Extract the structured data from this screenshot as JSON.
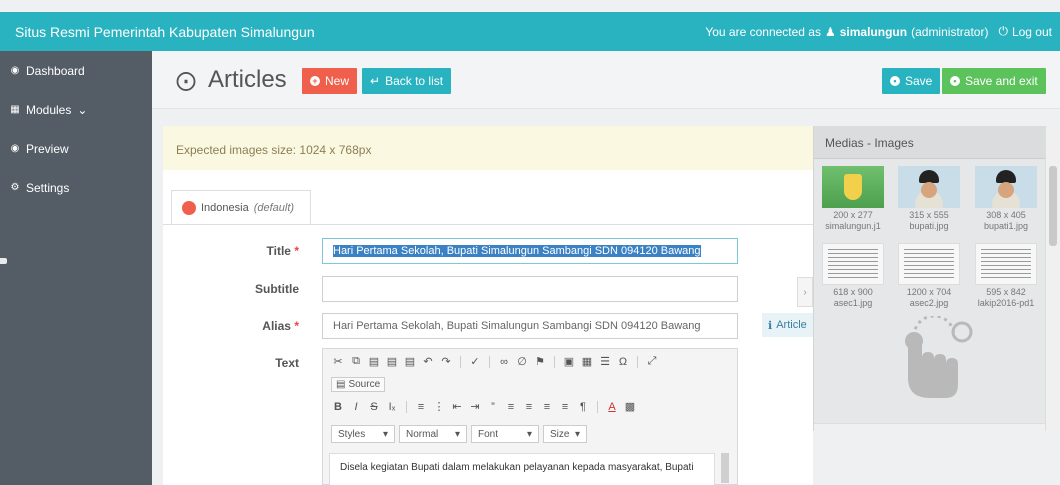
{
  "topbar": {
    "site_title": "Situs Resmi Pemerintah Kabupaten Simalungun",
    "connected_prefix": "You are connected as",
    "username": "simalungun",
    "role": "(administrator)",
    "logout_label": "Log out"
  },
  "sidebar": {
    "items": [
      {
        "label": "Dashboard",
        "icon": "dashboard-icon"
      },
      {
        "label": "Modules",
        "icon": "grid-icon",
        "chevron": "⌄"
      },
      {
        "label": "Preview",
        "icon": "eye-icon"
      },
      {
        "label": "Settings",
        "icon": "gear-icon"
      }
    ]
  },
  "header": {
    "title": "Articles",
    "new_label": "New",
    "back_label": "Back to list",
    "save_label": "Save",
    "save_exit_label": "Save and exit"
  },
  "form": {
    "notice": "Expected images size: 1024 x 768px",
    "language_tab": "Indonesia",
    "language_tab_note": "(default)",
    "title_label": "Title",
    "title_value": "Hari Pertama Sekolah, Bupati Simalungun Sambangi SDN 094120 Bawang",
    "subtitle_label": "Subtitle",
    "subtitle_value": "",
    "alias_label": "Alias",
    "alias_value": "Hari Pertama Sekolah, Bupati Simalungun Sambangi SDN 094120 Bawang",
    "text_label": "Text",
    "required_mark": "*",
    "article_hint": "Article"
  },
  "editor": {
    "source_label": "Source",
    "styles_label": "Styles",
    "format_label": "Normal",
    "font_label": "Font",
    "size_label": "Size",
    "body_text": "Disela kegiatan Bupati dalam melakukan pelayanan kepada masyarakat, Bupati"
  },
  "media": {
    "title": "Medias - Images",
    "items": [
      {
        "dims": "200 x 277",
        "name": "simalungun.j1"
      },
      {
        "dims": "315 x 555",
        "name": "bupati.jpg"
      },
      {
        "dims": "308 x 405",
        "name": "bupati1.jpg"
      },
      {
        "dims": "618 x 900",
        "name": "asec1.jpg"
      },
      {
        "dims": "1200 x 704",
        "name": "asec2.jpg"
      },
      {
        "dims": "595 x 842",
        "name": "lakip2016-pd1"
      }
    ]
  },
  "colors": {
    "accent": "#29b3c0",
    "danger": "#ef5f4b",
    "success": "#5cc25c",
    "sidebar": "#545d66"
  }
}
